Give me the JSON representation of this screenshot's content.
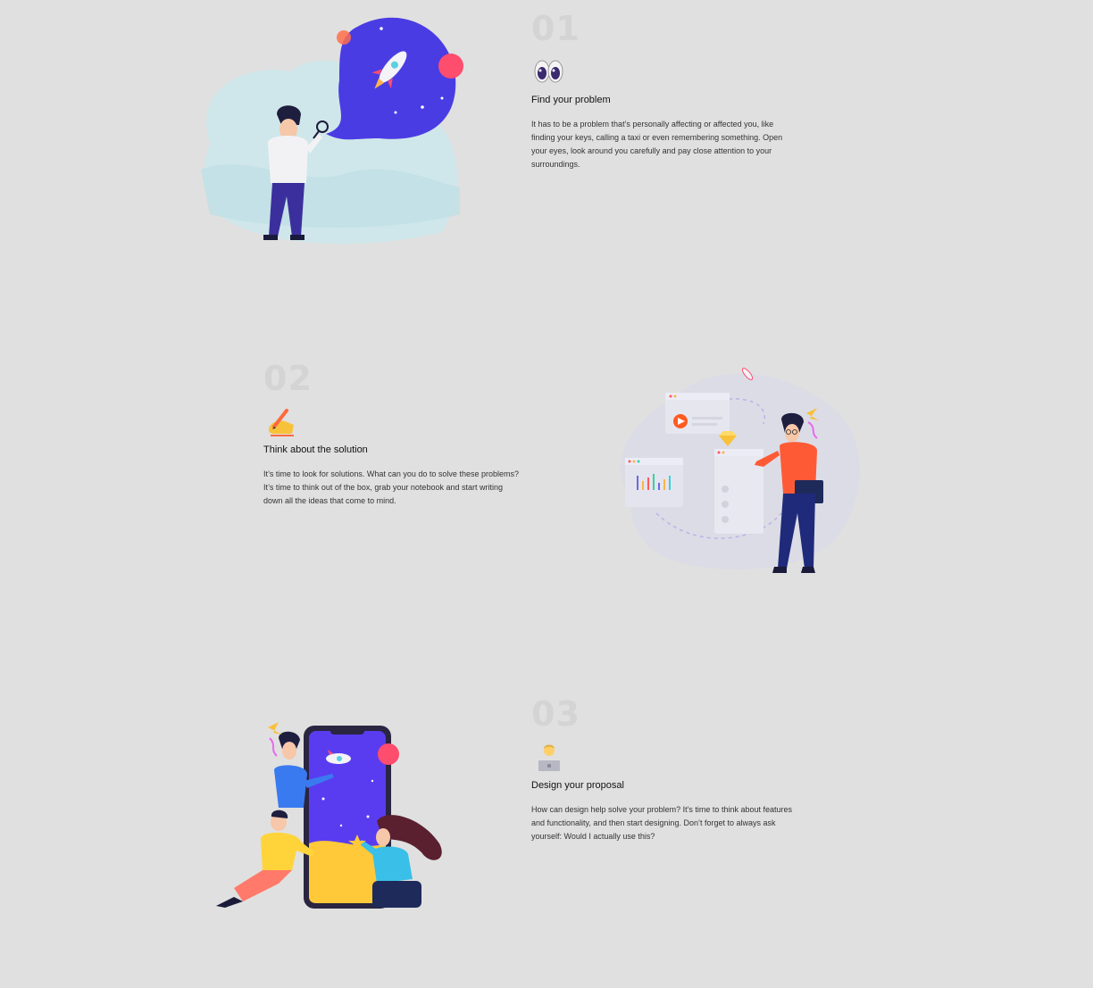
{
  "steps": [
    {
      "number": "01",
      "icon": "eyes-emoji",
      "title": "Find your problem",
      "description": "It has to be a problem that’s personally affecting or affected you, like finding your keys, calling a taxi or even remembering something. Open your eyes, look around you carefully and pay close attention to your surroundings."
    },
    {
      "number": "02",
      "icon": "writing-hand-emoji",
      "title": "Think about the solution",
      "description": "It’s time to look for solutions. What can you do to solve these problems? It’s time to think out of the box, grab your notebook and start writing down all the ideas that come to mind."
    },
    {
      "number": "03",
      "icon": "technologist-emoji",
      "title": "Design your proposal",
      "description": "How can design help solve your problem? It’s time to think about features and functionality, and then start designing. Don’t forget to always ask yourself: Would I actually use this?"
    }
  ],
  "illustrations": [
    {
      "name": "person-with-magnifier-rocket-illustration"
    },
    {
      "name": "person-with-app-screens-illustration"
    },
    {
      "name": "people-around-phone-illustration"
    }
  ],
  "colors": {
    "background": "#e0e0e0",
    "accent_purple": "#4b3bd9",
    "accent_pink": "#ff3d6e",
    "accent_orange": "#ff5a36",
    "step_number": "#d4d4d4"
  }
}
